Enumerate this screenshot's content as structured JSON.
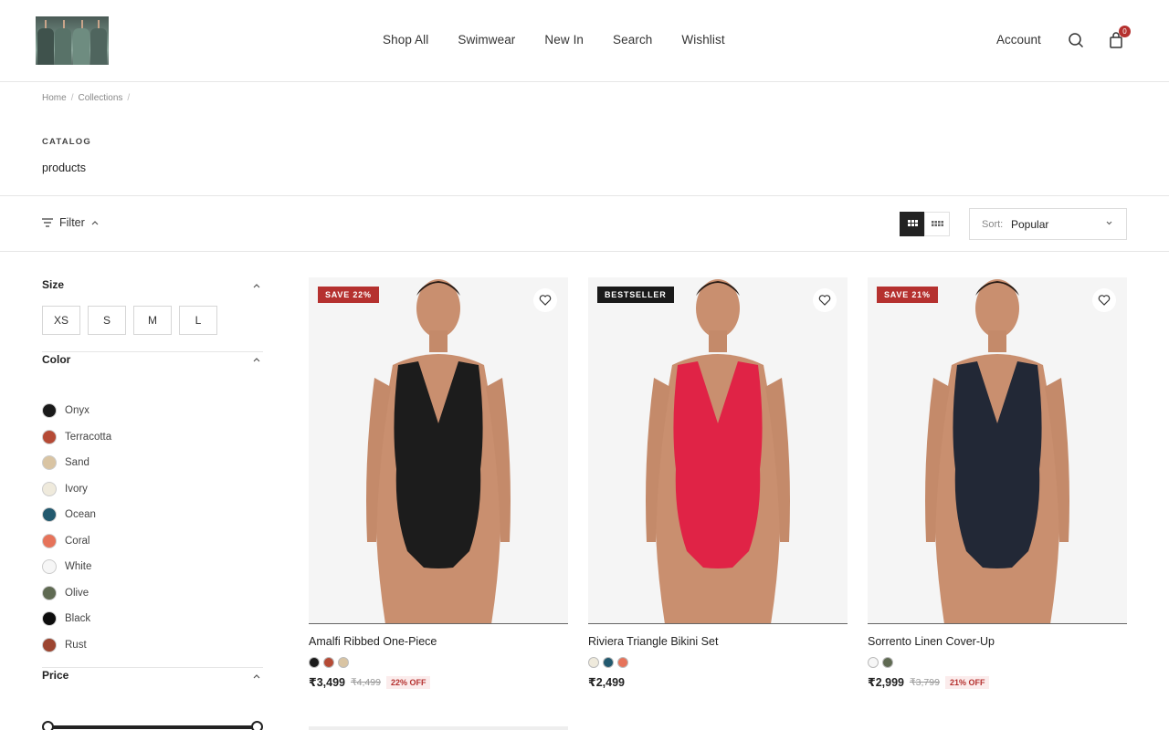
{
  "header": {
    "nav": [
      "Shop All",
      "Swimwear",
      "New In",
      "Search",
      "Wishlist"
    ],
    "account": "Account",
    "cart_count": "0"
  },
  "breadcrumb": [
    "Home",
    "Collections"
  ],
  "catalog": {
    "eyebrow": "CATALOG",
    "title": "products"
  },
  "toolbar": {
    "filter": "Filter",
    "sort_label": "Sort:",
    "sort_value": "Popular"
  },
  "filters": {
    "size": {
      "title": "Size",
      "options": [
        "XS",
        "S",
        "M",
        "L"
      ]
    },
    "color": {
      "title": "Color",
      "options": [
        {
          "name": "Onyx",
          "hex": "#1a1a1a"
        },
        {
          "name": "Terracotta",
          "hex": "#b54a35"
        },
        {
          "name": "Sand",
          "hex": "#d9c4a3"
        },
        {
          "name": "Ivory",
          "hex": "#efeadc"
        },
        {
          "name": "Ocean",
          "hex": "#22596e"
        },
        {
          "name": "Coral",
          "hex": "#e6735a"
        },
        {
          "name": "White",
          "hex": "#f6f6f6"
        },
        {
          "name": "Olive",
          "hex": "#5f6a52"
        },
        {
          "name": "Black",
          "hex": "#0d0d0d"
        },
        {
          "name": "Rust",
          "hex": "#9c4530"
        }
      ]
    },
    "price": {
      "title": "Price"
    }
  },
  "products": [
    {
      "badge": "SAVE 22%",
      "badge_color": "#b5312f",
      "name": "Amalfi Ribbed One-Piece",
      "price": "₹3,499",
      "was": "₹4,499",
      "off": "22% OFF",
      "swatches": [
        "#1a1a1a",
        "#b54a35",
        "#d9c4a3"
      ],
      "suit_color": "#1c1c1c"
    },
    {
      "badge": "BESTSELLER",
      "badge_color": "#1a1a1a",
      "name": "Riviera Triangle Bikini Set",
      "price": "₹2,499",
      "was": "",
      "off": "",
      "swatches": [
        "#efeadc",
        "#22596e",
        "#e6735a"
      ],
      "suit_color": "#e02346"
    },
    {
      "badge": "SAVE 21%",
      "badge_color": "#b5312f",
      "name": "Sorrento Linen Cover-Up",
      "price": "₹2,999",
      "was": "₹3,799",
      "off": "21% OFF",
      "swatches": [
        "#f6f6f6",
        "#5f6a52"
      ],
      "suit_color": "#222836"
    }
  ]
}
